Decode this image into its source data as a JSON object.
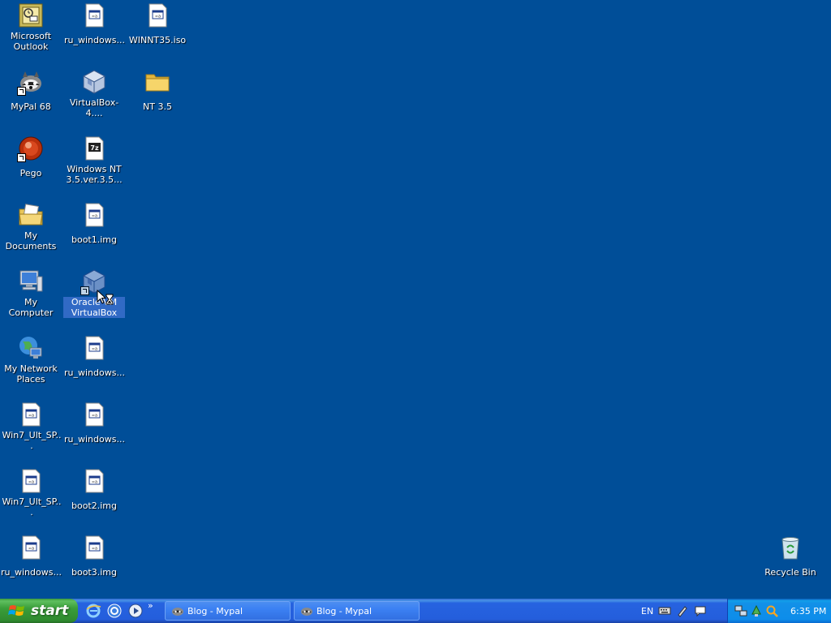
{
  "desktop": {
    "icons": [
      {
        "label": "Microsoft Outlook",
        "icon": "outlook-icon"
      },
      {
        "label": "ru_windows...",
        "icon": "file-icon"
      },
      {
        "label": "WINNT35.iso",
        "icon": "file-icon"
      },
      {
        "label": "MyPal 68",
        "icon": "mypal-icon"
      },
      {
        "label": "VirtualBox-4....",
        "icon": "virtualbox-icon"
      },
      {
        "label": "NT 3.5",
        "icon": "folder-icon"
      },
      {
        "label": "Pego",
        "icon": "pego-icon"
      },
      {
        "label": "Windows NT 3.5.ver.3.5...",
        "icon": "7z-archive-icon"
      },
      {
        "label": "My Documents",
        "icon": "my-documents-icon"
      },
      {
        "label": "boot1.img",
        "icon": "file-icon"
      },
      {
        "label": "My Computer",
        "icon": "my-computer-icon"
      },
      {
        "label": "Oracle VM VirtualBox",
        "icon": "virtualbox-icon"
      },
      {
        "label": "My Network Places",
        "icon": "network-places-icon"
      },
      {
        "label": "ru_windows...",
        "icon": "file-icon"
      },
      {
        "label": "Win7_Ult_SP...",
        "icon": "file-icon"
      },
      {
        "label": "ru_windows...",
        "icon": "file-icon"
      },
      {
        "label": "Win7_Ult_SP...",
        "icon": "file-icon"
      },
      {
        "label": "boot2.img",
        "icon": "file-icon"
      },
      {
        "label": "ru_windows...",
        "icon": "file-icon"
      },
      {
        "label": "boot3.img",
        "icon": "file-icon"
      },
      {
        "label": "Recycle Bin",
        "icon": "recycle-bin-icon"
      }
    ]
  },
  "taskbar": {
    "start_label": "start",
    "more_label": "»",
    "tasks": [
      {
        "label": "Blog - Mypal"
      },
      {
        "label": "Blog - Mypal"
      }
    ],
    "language": "EN",
    "clock": "6:35 PM"
  },
  "colors": {
    "desktop_bg": "#004e98",
    "taskbar_blue": "#245edc",
    "start_green": "#3a9d3a",
    "selection": "#316ac5"
  }
}
